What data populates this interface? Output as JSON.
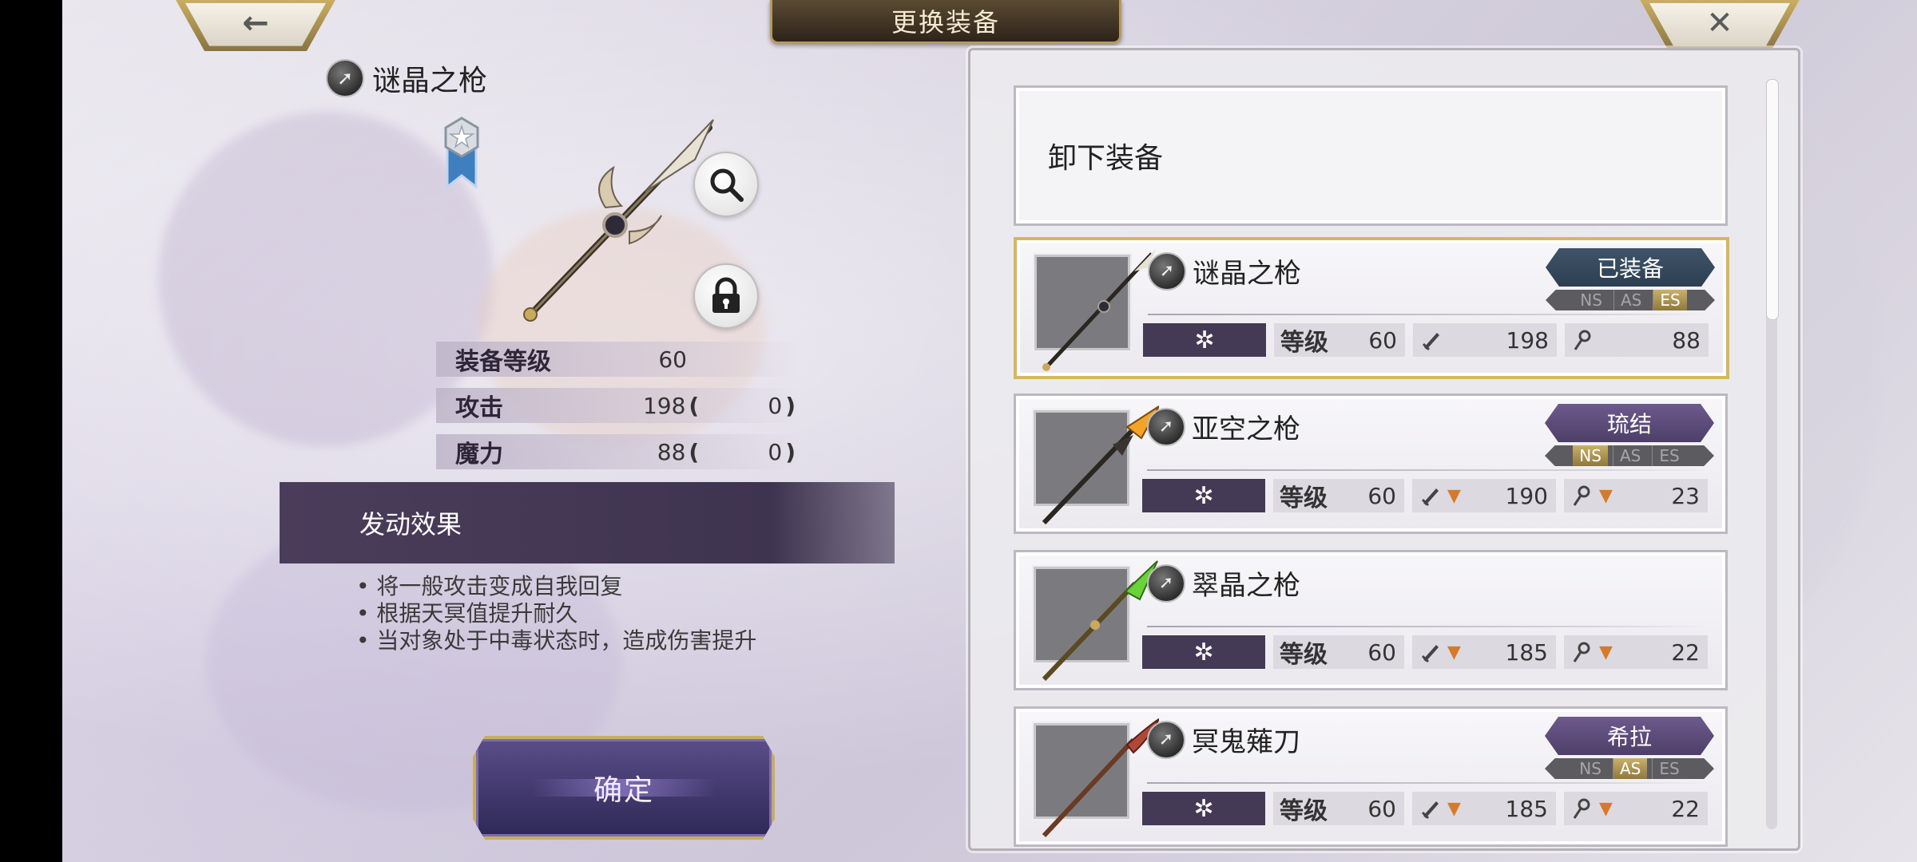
{
  "header": {
    "title": "更换装备",
    "back_glyph": "←",
    "close_glyph": "✕"
  },
  "detail": {
    "name": "谜晶之枪",
    "type_icon": "spear-type-icon",
    "stats": [
      {
        "label": "装备等级",
        "value": "60"
      },
      {
        "label": "攻击",
        "value": "198",
        "paren_open": "(",
        "bonus": "0",
        "paren_close": ")"
      },
      {
        "label": "魔力",
        "value": "88",
        "paren_open": "(",
        "bonus": "0",
        "paren_close": ")"
      }
    ],
    "effect_title": "发动效果",
    "effects": [
      "将一般攻击变成自我回复",
      "根据天冥值提升耐久",
      "当对象处于中毒状态时，造成伤害提升"
    ],
    "confirm_label": "确定"
  },
  "list": {
    "unequip_label": "卸下装备",
    "level_label": "等级",
    "attr_symbol": "✲",
    "slot_labels": [
      "NS",
      "AS",
      "ES"
    ],
    "items": [
      {
        "name": "谜晶之枪",
        "tag": "已装备",
        "level": "60",
        "atk": "198",
        "mag": "88",
        "atk_down": "",
        "mag_down": ""
      },
      {
        "name": "亚空之枪",
        "tag": "琉结",
        "level": "60",
        "atk": "190",
        "mag": "23",
        "atk_down": "▼",
        "mag_down": "▼"
      },
      {
        "name": "翠晶之枪",
        "tag": "",
        "level": "60",
        "atk": "185",
        "mag": "22",
        "atk_down": "▼",
        "mag_down": "▼"
      },
      {
        "name": "冥鬼薙刀",
        "tag": "希拉",
        "level": "60",
        "atk": "185",
        "mag": "22",
        "atk_down": "▼",
        "mag_down": "▼"
      }
    ]
  },
  "colors": {
    "gold": "#c7ad62",
    "panel_purple": "#453a55",
    "down_arrow": "#d67a2a"
  }
}
